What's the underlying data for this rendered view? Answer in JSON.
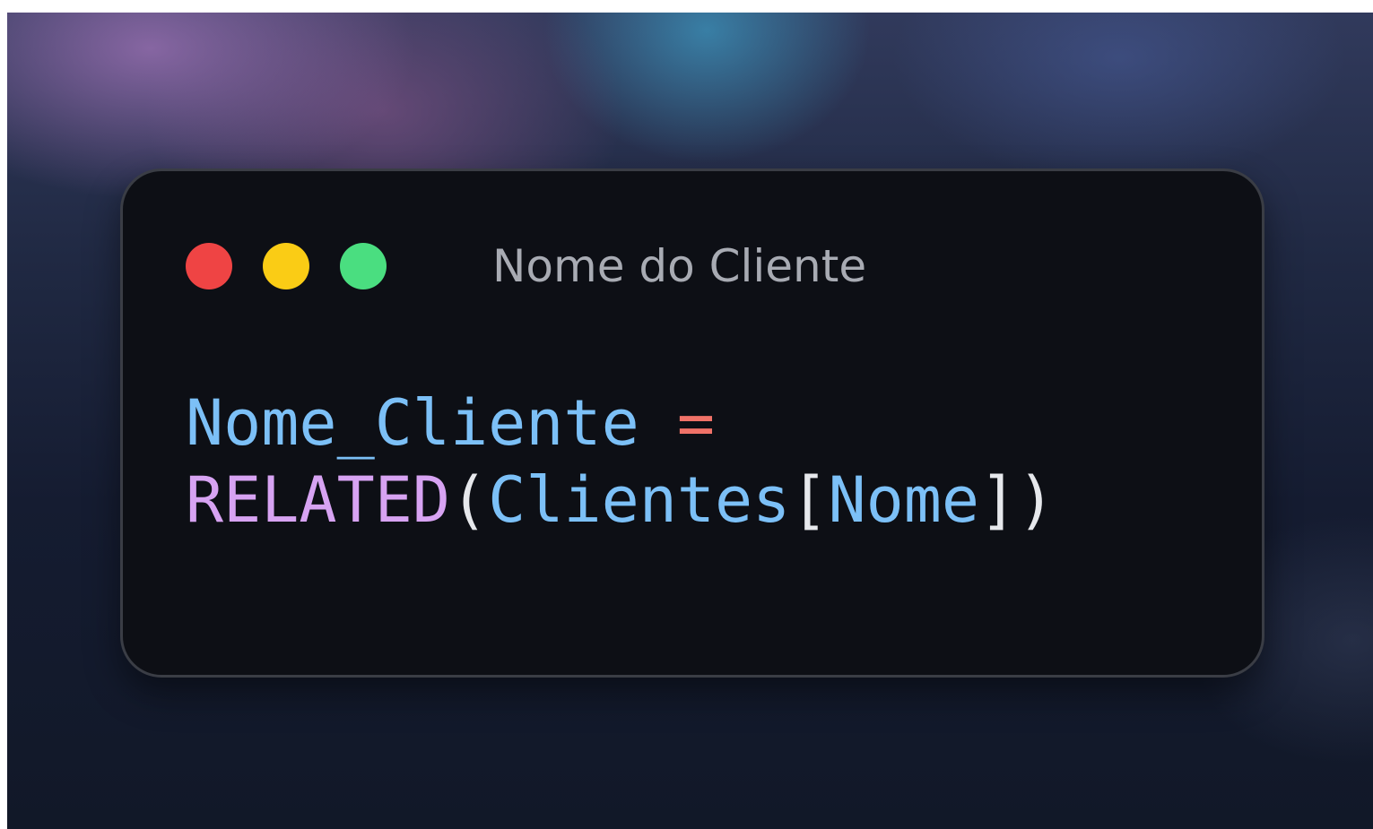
{
  "window": {
    "title": "Nome do Cliente",
    "controls": [
      {
        "name": "close",
        "color": "#ef4444"
      },
      {
        "name": "minimize",
        "color": "#facc15"
      },
      {
        "name": "maximize",
        "color": "#4ade80"
      }
    ]
  },
  "code": {
    "line1": {
      "identifier": "Nome_Cliente",
      "space": " ",
      "operator": "="
    },
    "line2": {
      "function": "RELATED",
      "open_paren": "(",
      "table": "Clientes",
      "open_bracket": "[",
      "column": "Nome",
      "close_bracket": "]",
      "close_paren": ")"
    }
  },
  "colors": {
    "identifier": "#7cc0f7",
    "operator": "#f07268",
    "function": "#d7a3f2",
    "punctuation": "#e6e8ec",
    "window_bg": "#0d0f15"
  }
}
